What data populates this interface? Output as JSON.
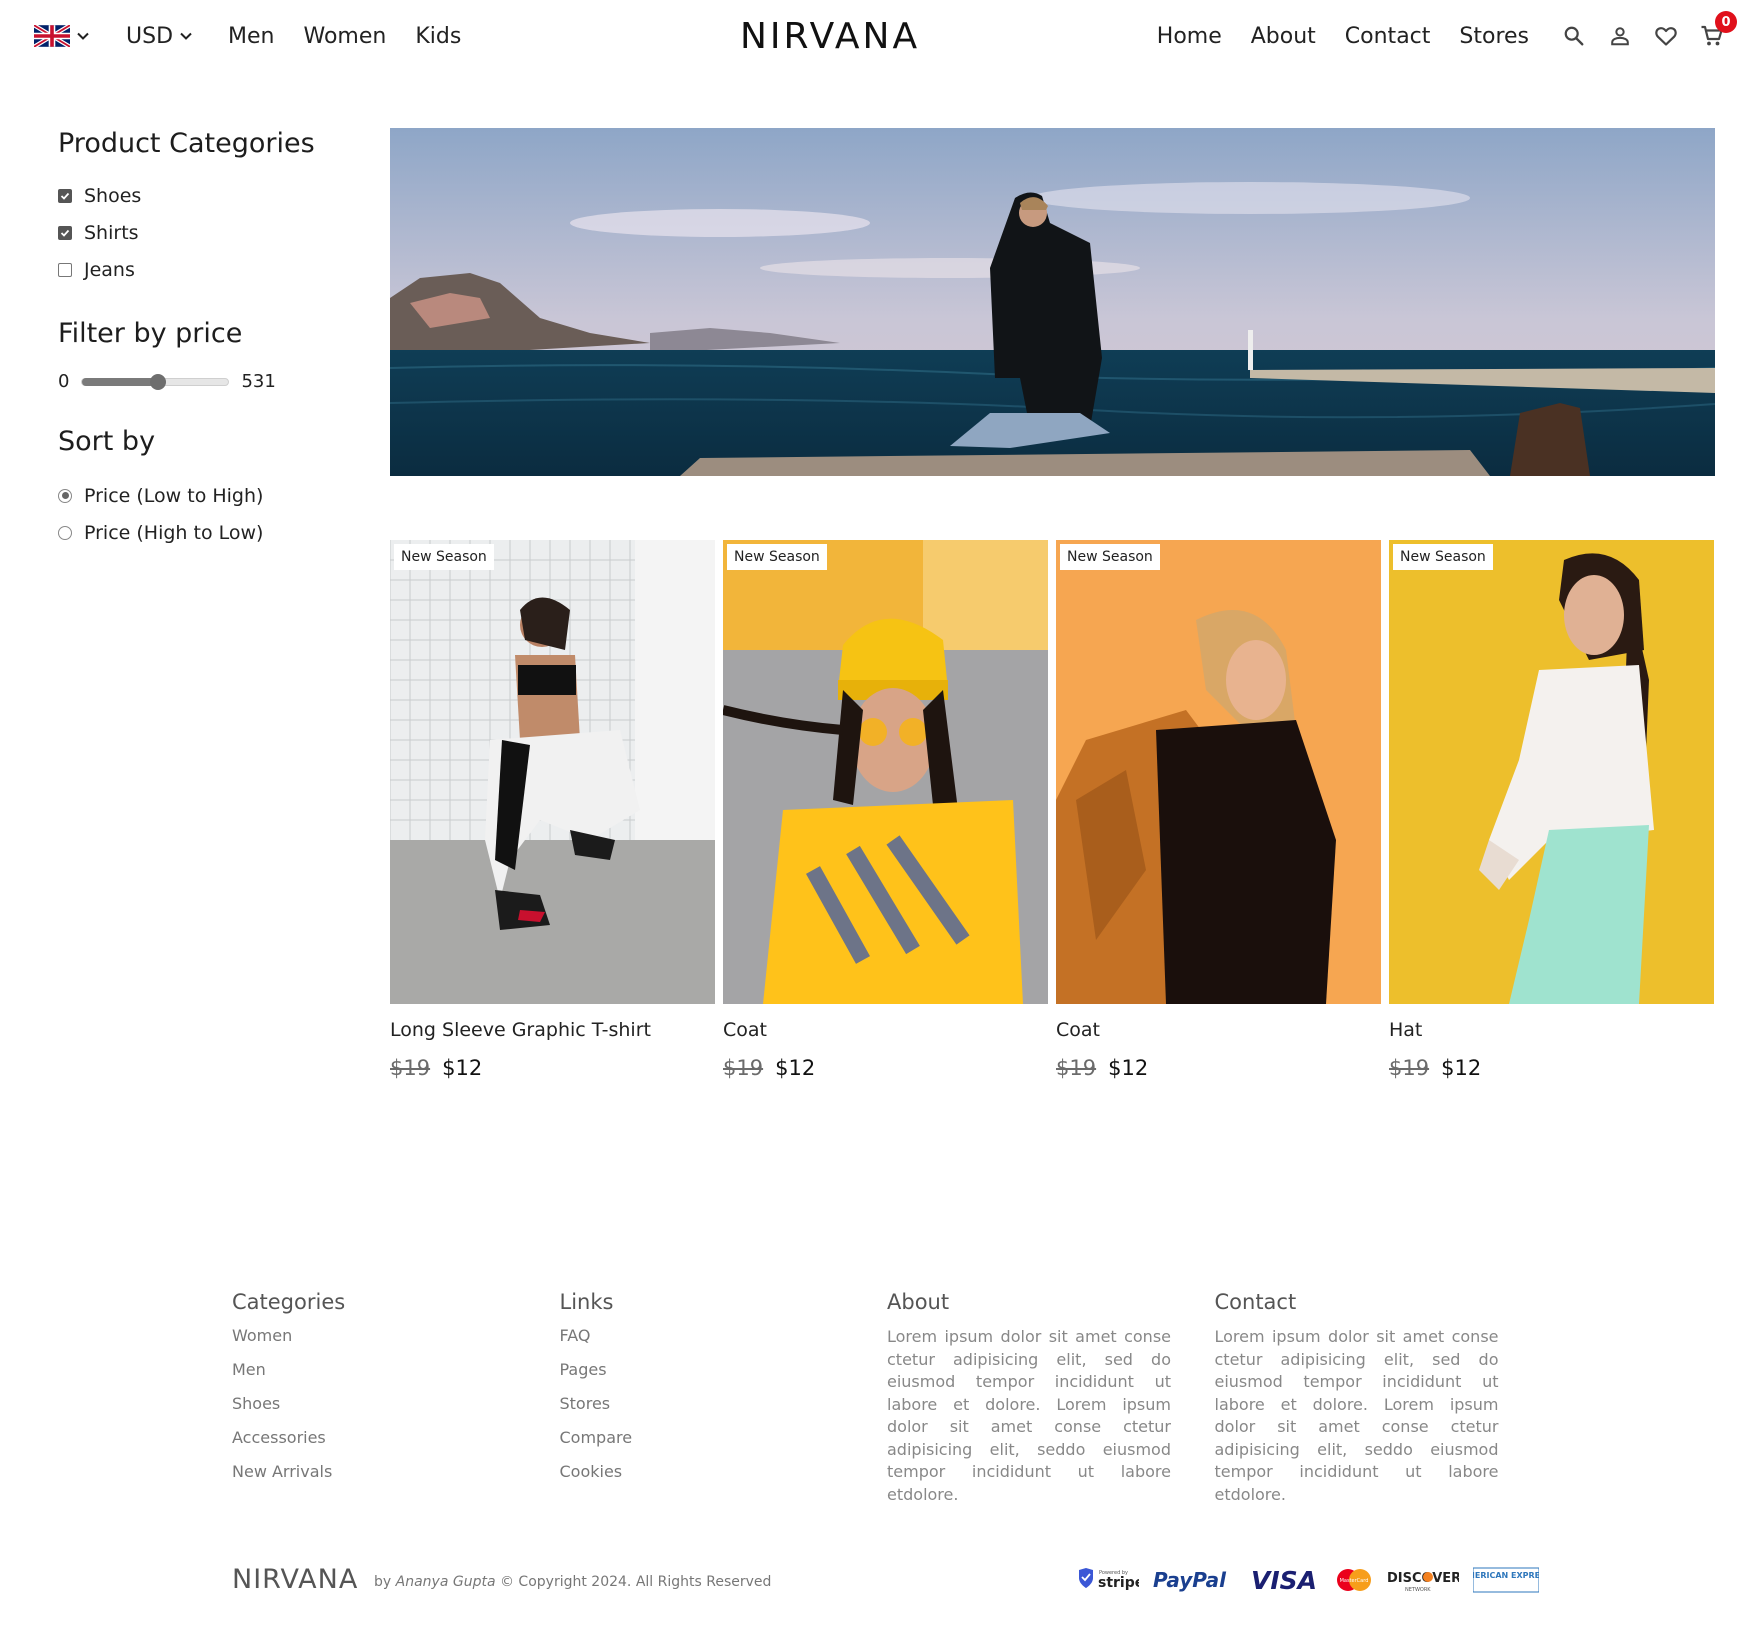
{
  "nav": {
    "currency": "USD",
    "left_links": [
      "Men",
      "Women",
      "Kids"
    ],
    "brand": "NIRVANA",
    "right_links": [
      "Home",
      "About",
      "Contact",
      "Stores"
    ],
    "cart_count": "0"
  },
  "sidebar": {
    "categories_heading": "Product Categories",
    "categories": [
      {
        "label": "Shoes",
        "checked": true
      },
      {
        "label": "Shirts",
        "checked": true
      },
      {
        "label": "Jeans",
        "checked": false
      }
    ],
    "price_heading": "Filter by price",
    "price_min": "0",
    "price_max": "531",
    "price_fraction": 0.52,
    "sort_heading": "Sort by",
    "sort_options": [
      {
        "label": "Price (Low to High)",
        "selected": true
      },
      {
        "label": "Price (High to Low)",
        "selected": false
      }
    ]
  },
  "products": [
    {
      "badge": "New Season",
      "title": "Long Sleeve Graphic T-shirt",
      "old_price": "$19",
      "price": "$12"
    },
    {
      "badge": "New Season",
      "title": "Coat",
      "old_price": "$19",
      "price": "$12"
    },
    {
      "badge": "New Season",
      "title": "Coat",
      "old_price": "$19",
      "price": "$12"
    },
    {
      "badge": "New Season",
      "title": "Hat",
      "old_price": "$19",
      "price": "$12"
    }
  ],
  "footer": {
    "categories": {
      "heading": "Categories",
      "items": [
        "Women",
        "Men",
        "Shoes",
        "Accessories",
        "New Arrivals"
      ]
    },
    "links": {
      "heading": "Links",
      "items": [
        "FAQ",
        "Pages",
        "Stores",
        "Compare",
        "Cookies"
      ]
    },
    "about": {
      "heading": "About",
      "text": "Lorem ipsum dolor sit amet conse ctetur adipisicing elit, sed do eiusmod tempor incididunt ut labore et dolore. Lorem ipsum dolor sit amet conse ctetur adipisicing elit, seddo eiusmod tempor incididunt ut labore etdolore."
    },
    "contact": {
      "heading": "Contact",
      "text": "Lorem ipsum dolor sit amet conse ctetur adipisicing elit, sed do eiusmod tempor incididunt ut labore et dolore. Lorem ipsum dolor sit amet conse ctetur adipisicing elit, seddo eiusmod tempor incididunt ut labore etdolore."
    },
    "brand": "NIRVANA",
    "copyright_prefix": "by",
    "author": "Ananya Gupta",
    "copyright_suffix": "© Copyright 2024. All Rights Reserved",
    "payment_methods": [
      "stripe",
      "PayPal",
      "VISA",
      "MasterCard",
      "DISCOVER",
      "AMERICAN EXPRESS"
    ],
    "stripe_caption": "Powered by",
    "mastercard_caption": "MasterCard",
    "discover_caption": "NETWORK"
  },
  "colors": {
    "cart_badge": "#e0101b",
    "text": "#222222",
    "muted": "#777777"
  }
}
